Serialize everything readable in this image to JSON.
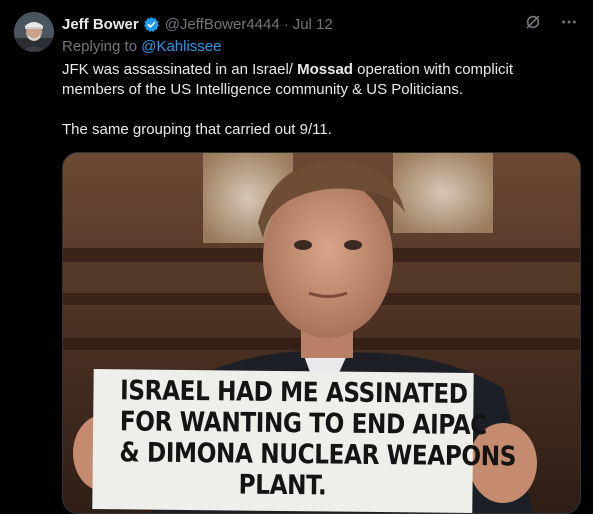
{
  "tweet": {
    "display_name": "Jeff Bower",
    "handle": "@JeffBower4444",
    "separator": "·",
    "date": "Jul 12",
    "reply_prefix": "Replying to",
    "reply_to": "@Kahlissee",
    "text_part1": "JFK was assassinated in an Israel/ ",
    "text_bold": "Mossad",
    "text_part2": " operation with complicit members of the US Intelligence community & US Politicians.",
    "text_para2": "The same grouping that carried out 9/11."
  },
  "media": {
    "sign_lines": [
      "ISRAEL HAD ME ASSINATED",
      "FOR WANTING TO END AIPAC",
      "& DIMONA NUCLEAR WEAPONS",
      "PLANT."
    ]
  },
  "icons": {
    "verified": "verified-badge-icon",
    "grok": "grok-icon",
    "more": "more-icon"
  },
  "colors": {
    "background": "#000000",
    "text": "#e7e9ea",
    "muted": "#71767b",
    "accent": "#1d9bf0"
  }
}
